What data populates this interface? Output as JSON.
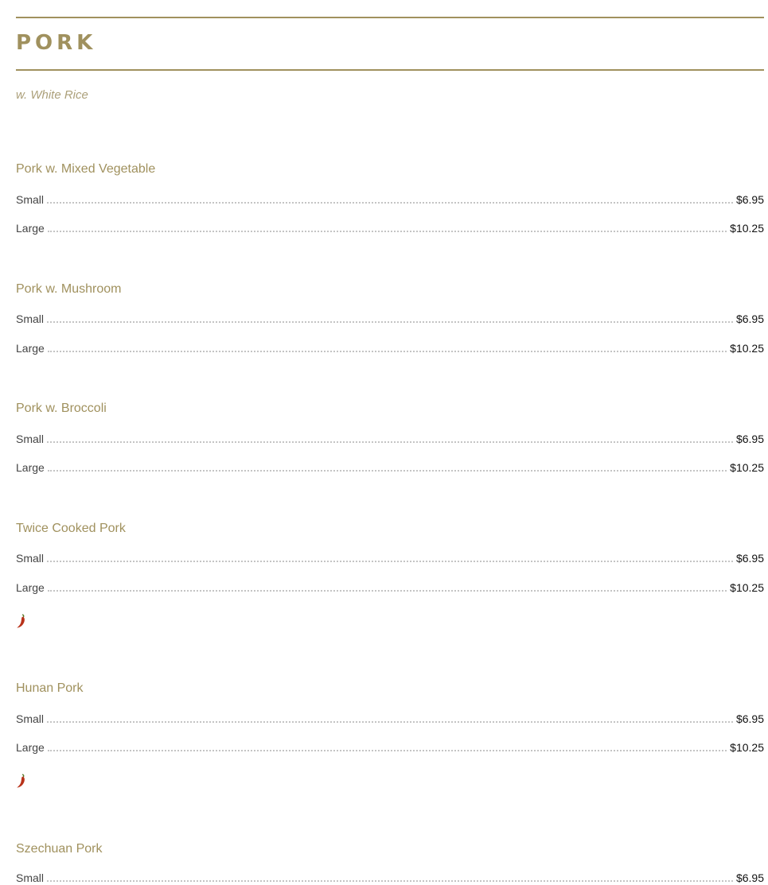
{
  "section": {
    "title": "PORK",
    "note": "w. White Rice"
  },
  "items": [
    {
      "name": "Pork w. Mixed Vegetable",
      "prices": [
        {
          "size": "Small",
          "price": "$6.95"
        },
        {
          "size": "Large",
          "price": "$10.25"
        }
      ],
      "spicy": false
    },
    {
      "name": "Pork w. Mushroom",
      "prices": [
        {
          "size": "Small",
          "price": "$6.95"
        },
        {
          "size": "Large",
          "price": "$10.25"
        }
      ],
      "spicy": false
    },
    {
      "name": "Pork w. Broccoli",
      "prices": [
        {
          "size": "Small",
          "price": "$6.95"
        },
        {
          "size": "Large",
          "price": "$10.25"
        }
      ],
      "spicy": false
    },
    {
      "name": "Twice Cooked Pork",
      "prices": [
        {
          "size": "Small",
          "price": "$6.95"
        },
        {
          "size": "Large",
          "price": "$10.25"
        }
      ],
      "spicy": true
    },
    {
      "name": "Hunan Pork",
      "prices": [
        {
          "size": "Small",
          "price": "$6.95"
        },
        {
          "size": "Large",
          "price": "$10.25"
        }
      ],
      "spicy": true
    },
    {
      "name": "Szechuan Pork",
      "prices": [
        {
          "size": "Small",
          "price": "$6.95"
        }
      ],
      "spicy": false
    }
  ],
  "icons": {
    "spicy": "chili-pepper-icon"
  },
  "colors": {
    "accent": "#a0915e",
    "note": "#aca07a",
    "spicy": "#b8321a"
  }
}
